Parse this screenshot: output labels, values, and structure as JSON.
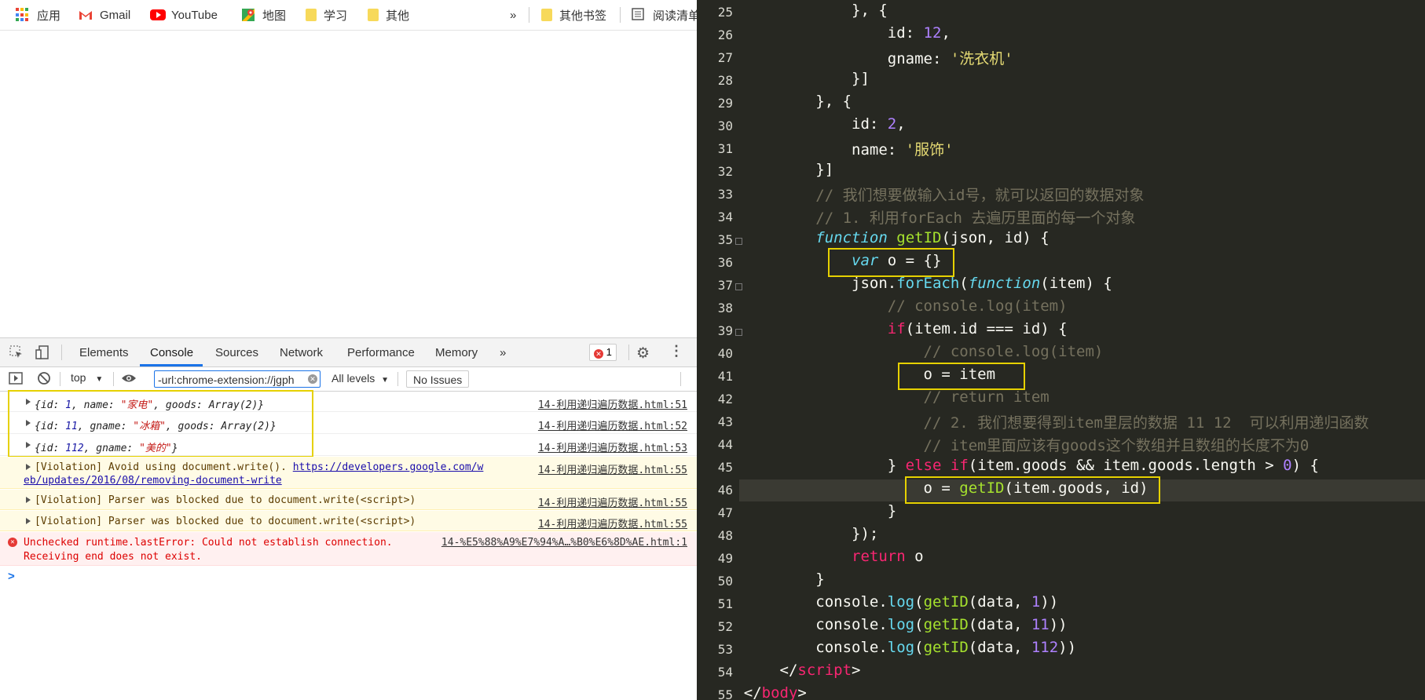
{
  "bookmarks": [
    {
      "label": "应用",
      "icon": "apps-grid-icon"
    },
    {
      "label": "Gmail",
      "icon": "gmail-icon"
    },
    {
      "label": "YouTube",
      "icon": "youtube-icon"
    },
    {
      "label": "地图",
      "icon": "maps-icon"
    },
    {
      "label": "学习",
      "icon": "folder-icon"
    },
    {
      "label": "其他",
      "icon": "folder-icon"
    },
    {
      "label": "»",
      "icon": "more-icon"
    },
    {
      "label": "其他书签",
      "icon": "folder-icon"
    },
    {
      "label": "阅读清单",
      "icon": "reading-list-icon"
    }
  ],
  "devtools": {
    "tabs": [
      "Elements",
      "Console",
      "Sources",
      "Network",
      "Performance",
      "Memory",
      "»"
    ],
    "active_tab": "Console",
    "error_count": "1",
    "context": "top",
    "filter_value": "-url:chrome-extension://jgph",
    "levels": "All levels",
    "issues": "No Issues",
    "logs": [
      {
        "kind": "obj",
        "text": "{id: 1, name: \"家电\", goods: Array(2)}",
        "source": "14-利用递归遍历数据.html:51"
      },
      {
        "kind": "obj",
        "text": "{id: 11, gname: \"冰箱\", goods: Array(2)}",
        "source": "14-利用递归遍历数据.html:52"
      },
      {
        "kind": "obj",
        "text": "{id: 112, gname: \"美的\"}",
        "source": "14-利用递归遍历数据.html:53"
      },
      {
        "kind": "warn",
        "text": "[Violation] Avoid using document.write(). ",
        "link": "https://developers.google.com/w",
        "link2": "eb/updates/2016/08/removing-document-write",
        "source": "14-利用递归遍历数据.html:55"
      },
      {
        "kind": "warn",
        "text": "[Violation] Parser was blocked due to document.write(<script>)",
        "source": "14-利用递归遍历数据.html:55"
      },
      {
        "kind": "warn",
        "text": "[Violation] Parser was blocked due to document.write(<script>)",
        "source": "14-利用递归遍历数据.html:55"
      },
      {
        "kind": "err",
        "text": "Unchecked runtime.lastError: Could not establish connection.",
        "text2": "Receiving end does not exist.",
        "source": "14-%E5%88%A9%E7%94%A…%B0%E6%8D%AE.html:1"
      }
    ],
    "prompt": ">"
  },
  "editor": {
    "lines": [
      {
        "n": "25",
        "html": "                }, {"
      },
      {
        "n": "26",
        "html": "                    id: <span class=\"nm\">12</span>,"
      },
      {
        "n": "27",
        "html": "                    gname: <span class=\"s\">'洗衣机'</span>"
      },
      {
        "n": "28",
        "html": "                }]"
      },
      {
        "n": "29",
        "html": "            }, {"
      },
      {
        "n": "30",
        "html": "                id: <span class=\"nm\">2</span>,"
      },
      {
        "n": "31",
        "html": "                name: <span class=\"s\">'服饰'</span>"
      },
      {
        "n": "32",
        "html": "            }]"
      },
      {
        "n": "33",
        "html": "            <span class=\"cm\">// 我们想要做输入id号，就可以返回的数据对象</span>"
      },
      {
        "n": "34",
        "html": "            <span class=\"cm\">// 1. 利用forEach 去遍历里面的每一个对象</span>"
      },
      {
        "n": "35",
        "html": "            <span class=\"fn\">function</span> <span class=\"fnc\">getID</span>(json, id) {"
      },
      {
        "n": "36",
        "html": "                <span class=\"fn\">var</span> o = {}"
      },
      {
        "n": "37",
        "html": "                json.<span class=\"fn\" style=\"font-style:normal\">forEach</span>(<span class=\"fn\">function</span>(item) {"
      },
      {
        "n": "38",
        "html": "                    <span class=\"cm\">// console.log(item)</span>"
      },
      {
        "n": "39",
        "html": "                    <span class=\"kw\">if</span>(item.id === id) {"
      },
      {
        "n": "40",
        "html": "                        <span class=\"cm\">// console.log(item)</span>"
      },
      {
        "n": "41",
        "html": "                        o = item"
      },
      {
        "n": "42",
        "html": "                        <span class=\"cm\">// return item</span>"
      },
      {
        "n": "43",
        "html": "                        <span class=\"cm\">// 2. 我们想要得到item里层的数据 11 12  可以利用递归函数</span>"
      },
      {
        "n": "44",
        "html": "                        <span class=\"cm\">// item里面应该有goods这个数组并且数组的长度不为0</span>"
      },
      {
        "n": "45",
        "html": "                    } <span class=\"kw\">else</span> <span class=\"kw\">if</span>(item.goods && item.goods.length > <span class=\"nm\">0</span>) {"
      },
      {
        "n": "46",
        "html": "                        o = <span class=\"fnc\">getID</span>(item.goods, id)"
      },
      {
        "n": "47",
        "html": "                    }"
      },
      {
        "n": "48",
        "html": "                });"
      },
      {
        "n": "49",
        "html": "                <span class=\"kw\">return</span> o"
      },
      {
        "n": "50",
        "html": "            }"
      },
      {
        "n": "51",
        "html": "            console.<span class=\"fn\" style=\"font-style:normal\">log</span>(<span class=\"fnc\">getID</span>(data, <span class=\"nm\">1</span>))"
      },
      {
        "n": "52",
        "html": "            console.<span class=\"fn\" style=\"font-style:normal\">log</span>(<span class=\"fnc\">getID</span>(data, <span class=\"nm\">11</span>))"
      },
      {
        "n": "53",
        "html": "            console.<span class=\"fn\" style=\"font-style:normal\">log</span>(<span class=\"fnc\">getID</span>(data, <span class=\"nm\">112</span>))"
      },
      {
        "n": "54",
        "html": "        &lt;/<span class=\"tag\">script</span>&gt;"
      },
      {
        "n": "55",
        "html": "    &lt;/<span class=\"tag\">body</span>&gt;"
      }
    ]
  },
  "colors": {
    "editor_bg": "#272822",
    "highlight_box": "#e6d100",
    "devtools_accent": "#1a73e8",
    "error_red": "#d00"
  }
}
